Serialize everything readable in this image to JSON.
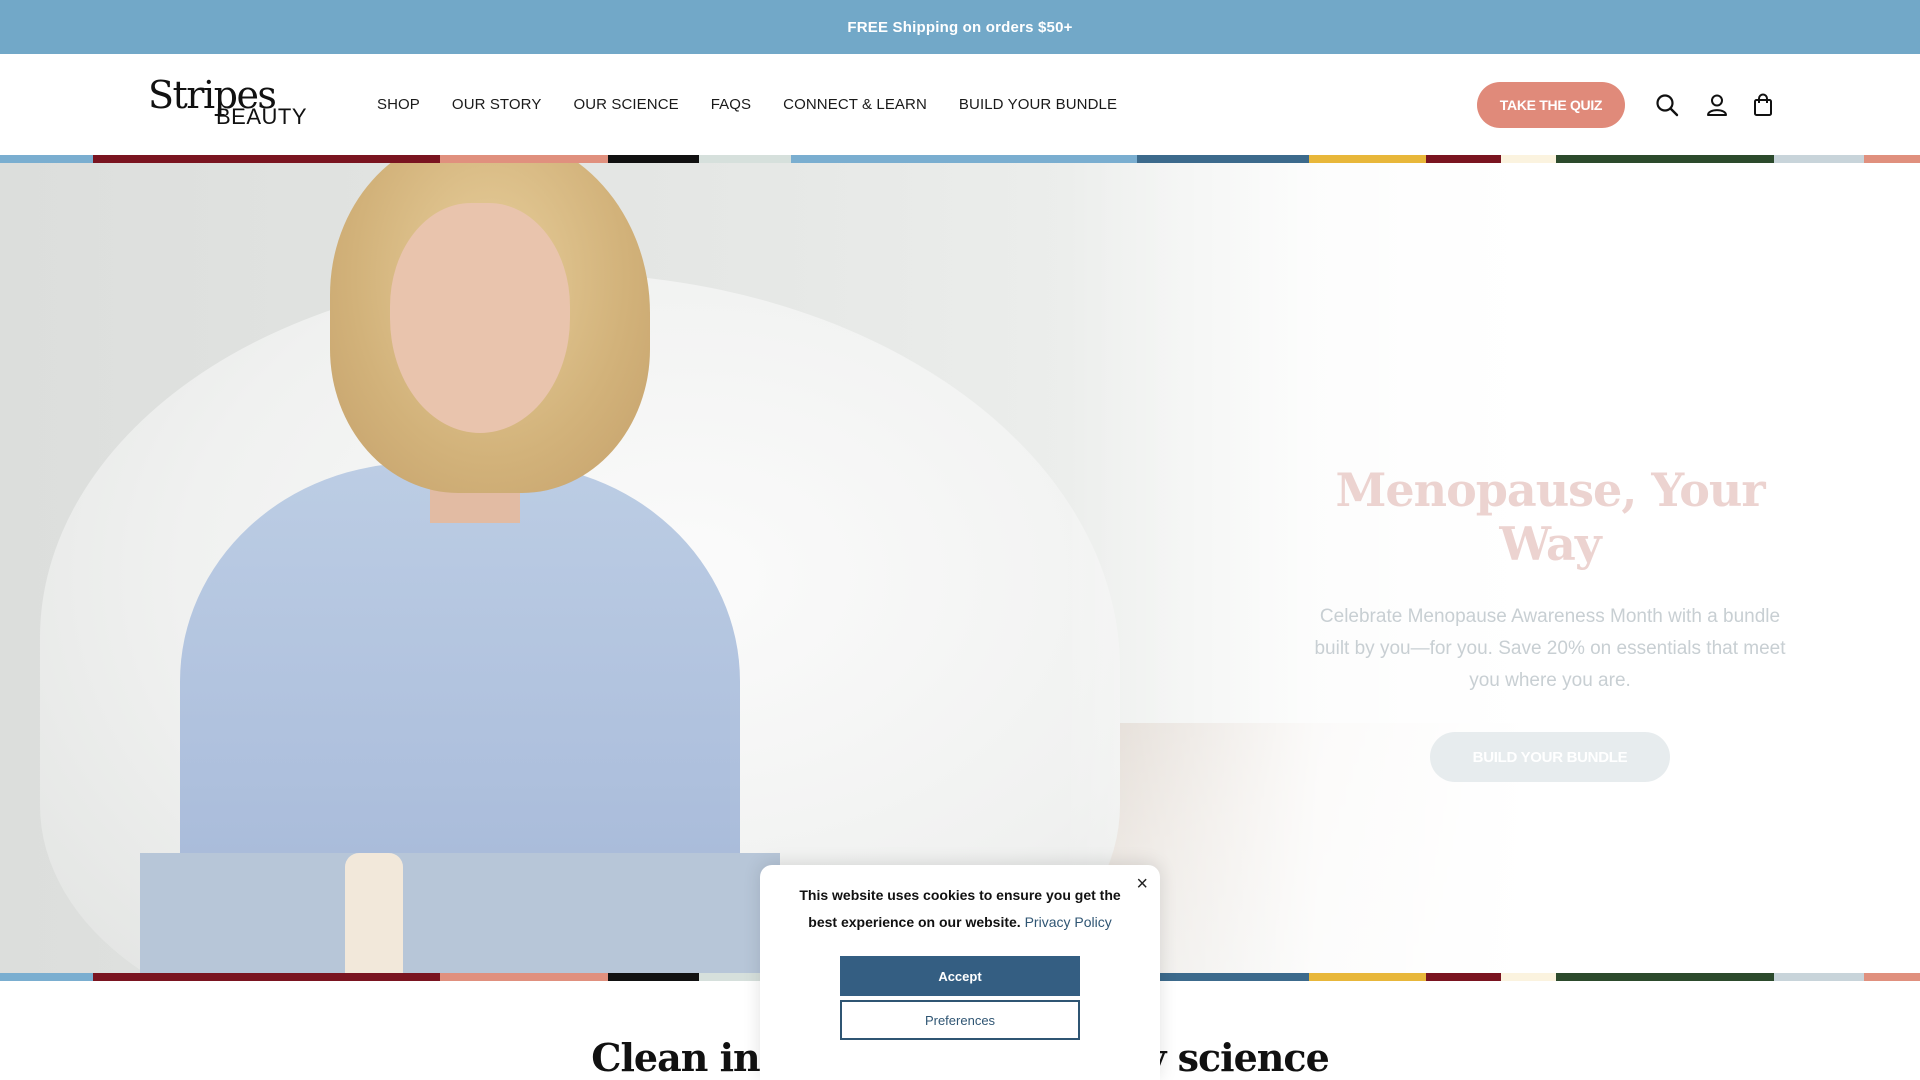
{
  "announcement": {
    "text": "FREE Shipping on orders $50+"
  },
  "header": {
    "logo": {
      "line1": "Stripes",
      "line2": "BEAUTY"
    },
    "nav": [
      {
        "label": "SHOP"
      },
      {
        "label": "OUR STORY"
      },
      {
        "label": "OUR SCIENCE"
      },
      {
        "label": "FAQS"
      },
      {
        "label": "CONNECT & LEARN"
      },
      {
        "label": "BUILD YOUR BUNDLE"
      }
    ],
    "quiz_button": "TAKE THE QUIZ",
    "icons": [
      "search-icon",
      "account-icon",
      "cart-icon"
    ]
  },
  "stripe_colors": [
    "#7aaed0",
    "#7a1420",
    "#e0907e",
    "#111111",
    "#d6e0dc",
    "#7aaed0",
    "#3c6a8c",
    "#e8b73a",
    "#7a1420",
    "#fbf3df",
    "#2c4a2c",
    "#c8d4da",
    "#e0907e"
  ],
  "hero": {
    "title": "Menopause, Your Way",
    "subtitle": "Celebrate Menopause Awareness Month with a bundle built by you—for you. Save 20% on essentials that meet you where you are.",
    "button": "BUILD YOUR BUNDLE"
  },
  "section": {
    "title": "Clean ingredients, driven by science"
  },
  "cookie": {
    "message": "This website uses cookies to ensure you get the best experience on our website.",
    "link": "Privacy Policy",
    "accept": "Accept",
    "preferences": "Preferences",
    "close": "×"
  },
  "colors": {
    "announcement_bg": "#72a8c8",
    "quiz_bg": "#e08a7a",
    "accept_bg": "#345e82"
  }
}
